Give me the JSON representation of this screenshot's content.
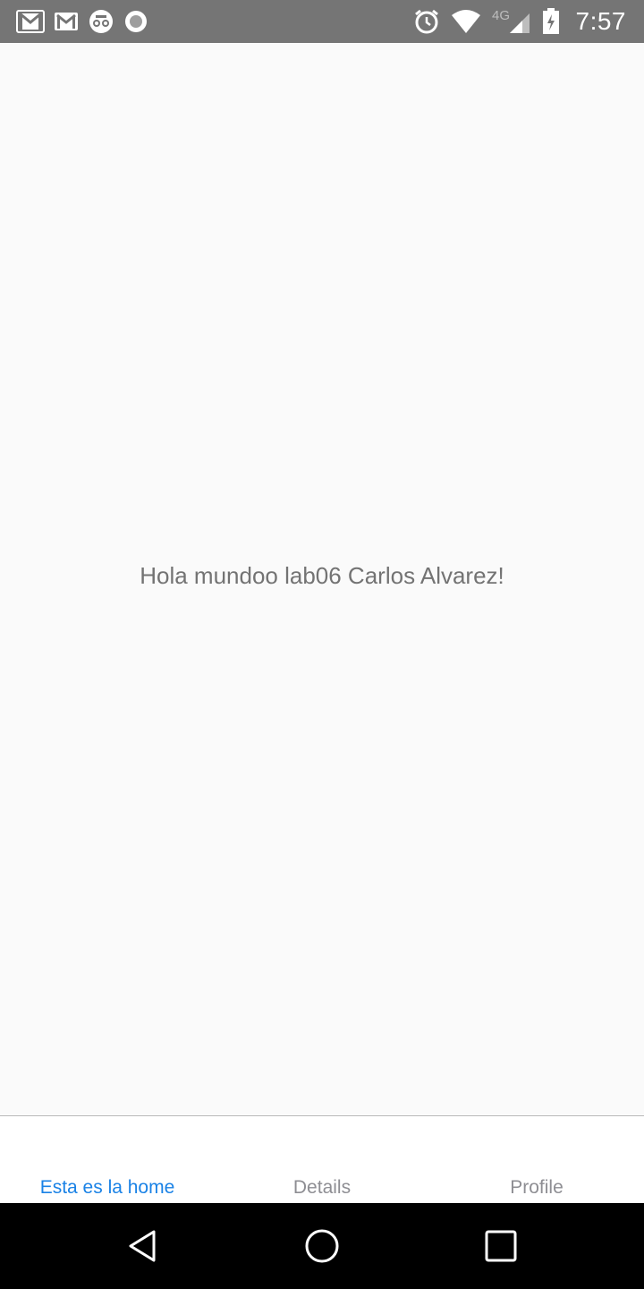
{
  "status_bar": {
    "time": "7:57",
    "network": "4G",
    "icons": {
      "left": [
        "gmail-icon",
        "mail-icon",
        "app-icon",
        "sync-icon"
      ],
      "right": [
        "alarm-icon",
        "wifi-icon",
        "signal-icon",
        "battery-icon"
      ]
    }
  },
  "main": {
    "greeting": "Hola mundoo lab06 Carlos Alvarez!"
  },
  "tabs": [
    {
      "label": "Esta es la home",
      "active": true
    },
    {
      "label": "Details",
      "active": false
    },
    {
      "label": "Profile",
      "active": false
    }
  ],
  "colors": {
    "active_tab": "#1a82e6",
    "inactive_tab": "#8e8e93",
    "status_bar": "#757575",
    "text": "#737373"
  },
  "nav_bar": {
    "icons": [
      "back-icon",
      "home-icon",
      "recents-icon"
    ]
  }
}
